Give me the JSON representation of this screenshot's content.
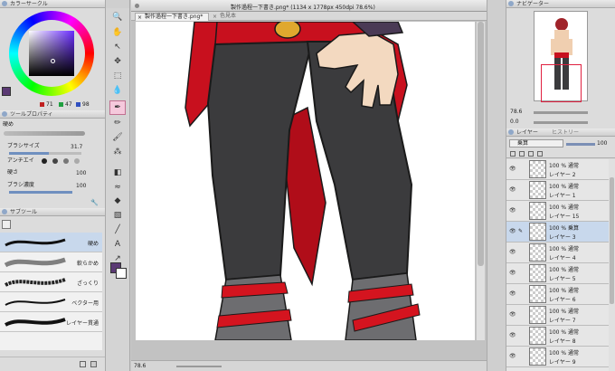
{
  "color_panel": {
    "title": "カラーサークル",
    "h": "71",
    "s": "47",
    "v": "98"
  },
  "tool_property": {
    "title": "ツールプロパティ",
    "tool_name": "硬め",
    "rows": [
      {
        "label": "ブラシサイズ",
        "value": "31.7"
      },
      {
        "label": "アンチエイ",
        "value": ""
      },
      {
        "label": "硬さ",
        "value": "100"
      },
      {
        "label": "ブラシ濃度",
        "value": "100"
      }
    ],
    "brush_size_fill": 0.55,
    "hardness_fill": 1.0,
    "density_fill": 1.0
  },
  "subtool": {
    "title": "サブツール",
    "brushes": [
      "硬め",
      "軟らかめ",
      "ざっくり",
      "ベクター用",
      "レイヤー貫通"
    ]
  },
  "canvas": {
    "tab_title": "製作過程一下書き.png* (1134 x 1778px 450dpi 78.6%)",
    "doc_tab": "製作過程一下書き.png*",
    "doc_tab2": "色見本",
    "zoom": "78.6"
  },
  "navigator": {
    "title": "ナビゲーター",
    "zoom": "78.6",
    "angle": "0.0"
  },
  "layers": {
    "tab": "レイヤー",
    "tab2": "ヒストリー",
    "blend_mode": "乗算",
    "opacity": "100",
    "items": [
      {
        "line1": "100 % 通常",
        "line2": "レイヤー 2"
      },
      {
        "line1": "100 % 通常",
        "line2": "レイヤー 1"
      },
      {
        "line1": "100 % 通常",
        "line2": "レイヤー 15"
      },
      {
        "line1": "100 % 乗算",
        "line2": "レイヤー 3"
      },
      {
        "line1": "100 % 通常",
        "line2": "レイヤー 4"
      },
      {
        "line1": "100 % 通常",
        "line2": "レイヤー 5"
      },
      {
        "line1": "100 % 通常",
        "line2": "レイヤー 6"
      },
      {
        "line1": "100 % 通常",
        "line2": "レイヤー 7"
      },
      {
        "line1": "100 % 通常",
        "line2": "レイヤー 8"
      },
      {
        "line1": "100 % 通常",
        "line2": "レイヤー 9"
      }
    ]
  },
  "colors": {
    "main_color": "#5b3a74",
    "accent": "#d03a8a",
    "selected_layer": "#c8d8ec"
  }
}
